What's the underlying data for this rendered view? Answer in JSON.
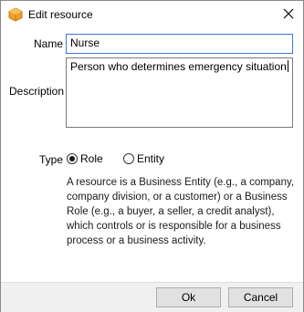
{
  "window": {
    "title": "Edit resource",
    "icon": "app-cube-icon",
    "close_icon": "close-icon"
  },
  "form": {
    "name_label": "Name",
    "name_value": "Nurse",
    "description_label": "Description",
    "description_value": "Person who determines emergency situation",
    "type_label": "Type",
    "type_options": [
      {
        "label": "Role",
        "selected": true
      },
      {
        "label": "Entity",
        "selected": false
      }
    ],
    "help_text": "A resource is a Business Entity (e.g., a company, company division, or a customer) or a Business Role (e.g., a buyer, a seller, a credit analyst), which controls or is responsible for a business process or a business activity."
  },
  "footer": {
    "ok_label": "Ok",
    "cancel_label": "Cancel"
  },
  "colors": {
    "accent": "#3c78d8",
    "icon_orange": "#f0a030"
  }
}
